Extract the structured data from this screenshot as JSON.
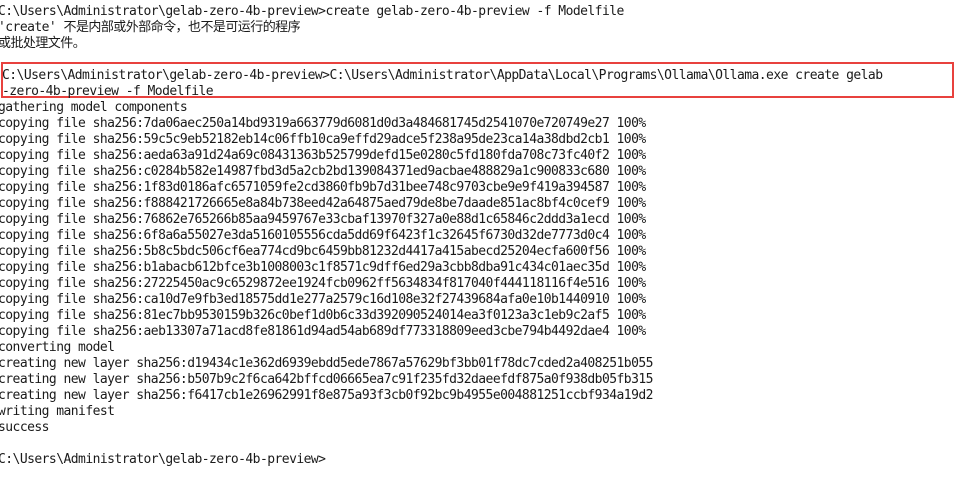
{
  "terminal": {
    "lines": [
      "C:\\Users\\Administrator\\gelab-zero-4b-preview>create gelab-zero-4b-preview -f Modelfile",
      "'create' 不是内部或外部命令，也不是可运行的程序",
      "或批处理文件。",
      "",
      "C:\\Users\\Administrator\\gelab-zero-4b-preview>C:\\Users\\Administrator\\AppData\\Local\\Programs\\Ollama\\Ollama.exe create gelab",
      "-zero-4b-preview -f Modelfile",
      "gathering model components",
      "copying file sha256:7da06aec250a14bd9319a663779d6081d0d3a484681745d2541070e720749e27 100%",
      "copying file sha256:59c5c9eb52182eb14c06ffb10ca9effd29adce5f238a95de23ca14a38dbd2cb1 100%",
      "copying file sha256:aeda63a91d24a69c08431363b525799defd15e0280c5fd180fda708c73fc40f2 100%",
      "copying file sha256:c0284b582e14987fbd3d5a2cb2bd139084371ed9acbae488829a1c900833c680 100%",
      "copying file sha256:1f83d0186afc6571059fe2cd3860fb9b7d31bee748c9703cbe9e9f419a394587 100%",
      "copying file sha256:f888421726665e8a84b738eed42a64875aed79de8be7daade851ac8bf4c0cef9 100%",
      "copying file sha256:76862e765266b85aa9459767e33cbaf13970f327a0e88d1c65846c2ddd3a1ecd 100%",
      "copying file sha256:6f8a6a55027e3da5160105556cda5dd69f6423f1c32645f6730d32de7773d0c4 100%",
      "copying file sha256:5b8c5bdc506cf6ea774cd9bc6459bb81232d4417a415abecd25204ecfa600f56 100%",
      "copying file sha256:b1abacb612bfce3b1008003c1f8571c9dff6ed29a3cbb8dba91c434c01aec35d 100%",
      "copying file sha256:27225450ac9c6529872ee1924fcb0962ff5634834f817040f444118116f4e516 100%",
      "copying file sha256:ca10d7e9fb3ed18575dd1e277a2579c16d108e32f27439684afa0e10b1440910 100%",
      "copying file sha256:81ec7bb9530159b326c0bef1d0b6c33d392090524014ea3f0123a3c1eb9c2af5 100%",
      "copying file sha256:aeb13307a71acd8fe81861d94ad54ab689df773318809eed3cbe794b4492dae4 100%",
      "converting model",
      "creating new layer sha256:d19434c1e362d6939ebdd5ede7867a57629bf3bb01f78dc7cded2a408251b055",
      "creating new layer sha256:b507b9c2f6ca642bffcd06665ea7c91f235fd32daeefdf875a0f938db05fb315",
      "creating new layer sha256:f6417cb1e26962991f8e875a93f3cb0f92bc9b4955e004881251ccbf934a19d2",
      "writing manifest",
      "success",
      "",
      "C:\\Users\\Administrator\\gelab-zero-4b-preview>"
    ]
  },
  "colors": {
    "background": "#ffffff",
    "text": "#1a1a1a",
    "highlight_border": "#e8413e"
  }
}
